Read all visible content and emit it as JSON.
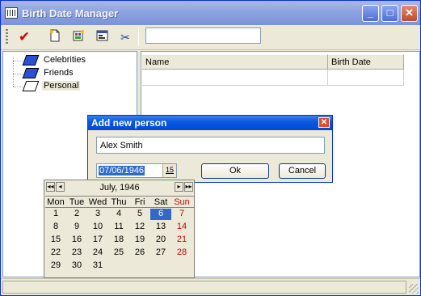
{
  "window": {
    "title": "Birth Date Manager",
    "minimize": "_",
    "maximize": "□",
    "close": "✕"
  },
  "toolbar": {
    "check_icon": "✔",
    "new_icon": "new-document-icon",
    "import_icon": "import-icon",
    "properties_icon": "properties-icon",
    "cut_icon": "✂",
    "search_value": ""
  },
  "tree": {
    "items": [
      {
        "label": "Celebrities",
        "icon": "blue-book-icon"
      },
      {
        "label": "Friends",
        "icon": "blue-book-icon"
      },
      {
        "label": "Personal",
        "icon": "open-book-icon"
      }
    ]
  },
  "grid": {
    "columns": [
      "Name",
      "Birth Date"
    ]
  },
  "dialog": {
    "title": "Add new person",
    "close": "✕",
    "name_value": "Alex Smith",
    "date_value": "07/06/1946",
    "date_button": "15",
    "ok_label": "Ok",
    "cancel_label": "Cancel"
  },
  "calendar": {
    "prev_year": "◂◂",
    "prev_month": "◂",
    "next_month": "▸",
    "next_year": "▸▸",
    "month_label": "July, 1946",
    "weekdays": [
      "Mon",
      "Tue",
      "Wed",
      "Thu",
      "Fri",
      "Sat",
      "Sun"
    ],
    "weeks": [
      [
        "1",
        "2",
        "3",
        "4",
        "5",
        "6",
        "7"
      ],
      [
        "8",
        "9",
        "10",
        "11",
        "12",
        "13",
        "14"
      ],
      [
        "15",
        "16",
        "17",
        "18",
        "19",
        "20",
        "21"
      ],
      [
        "22",
        "23",
        "24",
        "25",
        "26",
        "27",
        "28"
      ],
      [
        "29",
        "30",
        "31",
        "",
        "",
        "",
        ""
      ]
    ],
    "selected_day": "6"
  },
  "colors": {
    "titlebar": "#8fa6e2",
    "dialog_titlebar": "#0a5ae0",
    "selection": "#316ac5",
    "sunday": "#d00000"
  }
}
